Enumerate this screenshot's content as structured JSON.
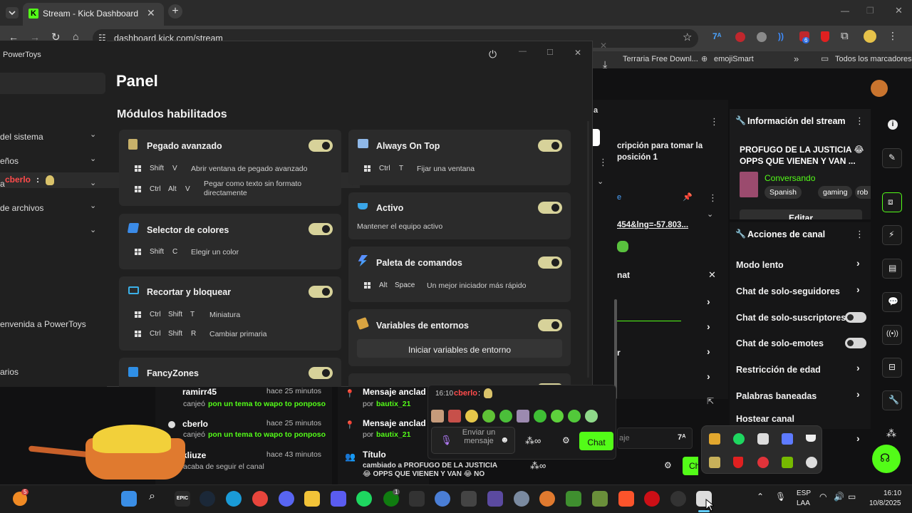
{
  "browser": {
    "tab_title": "Stream - Kick Dashboard",
    "new_tab": "+",
    "address": "dashboard.kick.com/stream",
    "bookmarks": [
      "Terraria Free Downl...",
      "emojiSmart",
      "Todos los marcadores"
    ],
    "bookmarks_more": "»",
    "extension_badge": "6"
  },
  "powertoys": {
    "app_title": "PowerToys",
    "page_title": "Panel",
    "section_title": "Módulos habilitados",
    "nav": [
      "del sistema",
      "eños",
      "a",
      "de archivos",
      "",
      "envenida a PowerToys",
      "arios"
    ],
    "modules_left": [
      {
        "name": "Pegado avanzado",
        "shortcuts": [
          {
            "keys": [
              "Shift",
              "V"
            ],
            "desc": "Abrir ventana de pegado avanzado"
          },
          {
            "keys": [
              "Ctrl",
              "Alt",
              "V"
            ],
            "desc": "Pegar como texto sin formato directamente"
          }
        ]
      },
      {
        "name": "Selector de colores",
        "shortcuts": [
          {
            "keys": [
              "Shift",
              "C"
            ],
            "desc": "Elegir un color"
          }
        ]
      },
      {
        "name": "Recortar y bloquear",
        "shortcuts": [
          {
            "keys": [
              "Ctrl",
              "Shift",
              "T"
            ],
            "desc": "Miniatura"
          },
          {
            "keys": [
              "Ctrl",
              "Shift",
              "R"
            ],
            "desc": "Cambiar primaria"
          }
        ]
      },
      {
        "name": "FancyZones",
        "shortcuts": []
      }
    ],
    "modules_right": [
      {
        "name": "Always On Top",
        "shortcuts": [
          {
            "keys": [
              "Ctrl",
              "T"
            ],
            "desc": "Fijar una ventana"
          }
        ]
      },
      {
        "name": "Activo",
        "desc": "Mantener el equipo activo"
      },
      {
        "name": "Paleta de comandos",
        "shortcuts": [
          {
            "keys": [
              "Alt",
              "Space"
            ],
            "desc": "Un mejor iniciador más rápido"
          }
        ]
      },
      {
        "name": "Variables de entornos",
        "button": "Iniciar variables de entorno"
      }
    ]
  },
  "overlay_chat": {
    "user": "cberlo",
    "colon": ":"
  },
  "stream_info": {
    "header": "Información del stream",
    "title": "PROFUGO DE LA JUSTICIA 😂 OPPS QUE VIENEN Y VAN ...",
    "category": "Conversando",
    "tags": [
      "Spanish",
      "gaming",
      "rob"
    ],
    "edit": "Editar"
  },
  "behind_text": {
    "line1": "cripción para tomar la",
    "line2": "posición 1",
    "link": "454&lng=-57.803...",
    "nat": "nat",
    "r": "r",
    "a": "a",
    "e": "e"
  },
  "channel_actions": {
    "header": "Acciones de canal",
    "items": [
      {
        "label": "Modo lento",
        "type": "chevron"
      },
      {
        "label": "Chat de solo-seguidores",
        "type": "chevron"
      },
      {
        "label": "Chat de solo-suscriptores",
        "type": "toggle"
      },
      {
        "label": "Chat de solo-emotes",
        "type": "toggle"
      },
      {
        "label": "Restricción de edad",
        "type": "chevron"
      },
      {
        "label": "Palabras baneadas",
        "type": "chevron"
      },
      {
        "label": "Hostear canal",
        "type": "none"
      }
    ]
  },
  "activity": [
    {
      "user": "ramirr45",
      "time": "hace 25 minutos",
      "prefix": "canjeó",
      "reward": "pon un tema to wapo to ponposo"
    },
    {
      "user": "cberlo",
      "time": "hace 25 minutos",
      "prefix": "canjeó",
      "reward": "pon un tema to wapo to ponposo"
    },
    {
      "user": "kliuze",
      "time": "hace 43 minutos",
      "prefix": "acaba de seguir el canal",
      "reward": ""
    }
  ],
  "pinned": [
    {
      "title": "Mensaje anclad",
      "by": "por",
      "user": "bautix_21"
    },
    {
      "title": "Mensaje anclad",
      "by": "por",
      "user": "bautix_21"
    },
    {
      "title": "Título",
      "text": "cambiado a PROFUGO DE LA JUSTICIA 😂 OPPS QUE VIENEN Y VAN 😂 NO"
    }
  ],
  "chat_popup": {
    "time": "16:10",
    "user": "cberlo",
    "placeholder": "Enviar un mensaje",
    "send": "Chat",
    "partial_placeholder": "aje",
    "ch_partial": "Ch"
  },
  "taskbar": {
    "lang1": "ESP",
    "lang2": "LAA",
    "time": "16:10",
    "date": "10/8/2025",
    "notif_badge": "5",
    "xbox_badge": "1"
  },
  "colors": {
    "kick_green": "#53fc18",
    "toggle_on": "#d7d29a",
    "reward_green": "#53fc18",
    "user_red": "#ff4b4b"
  }
}
